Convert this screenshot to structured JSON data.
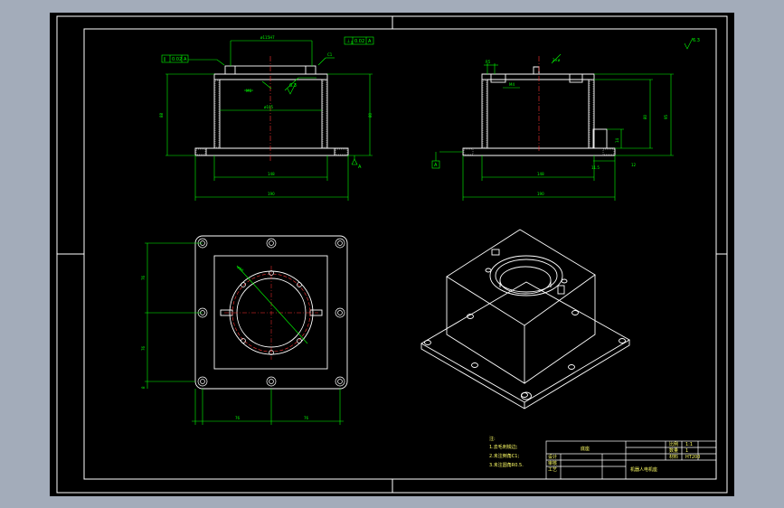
{
  "colors": {
    "background": "#a3acba",
    "canvas": "#000000",
    "frame": "#ffffff",
    "dimension": "#00ff00",
    "centerline": "#ff3333",
    "text": "#ffff66"
  },
  "roughness_symbol": "6.3",
  "front_view": {
    "fcf_left": [
      "∥",
      "0.02",
      "A"
    ],
    "fcf_right": [
      "⊥",
      "0.02",
      "A"
    ],
    "datum": "A"
  },
  "side_view": {
    "datum": "A"
  },
  "notes": {
    "title": "注:",
    "items": [
      "1.去毛刺锐边;",
      "2.未注倒角C1;",
      "3.未注圆角R0.5."
    ]
  },
  "title_block": {
    "part_name": "底座",
    "drawing_name": "机器人电机座",
    "row_labels": [
      "设计",
      "审核",
      "工艺"
    ],
    "info": [
      "比例",
      "1:1",
      "数量",
      "1",
      "材料",
      "HT200"
    ]
  }
}
